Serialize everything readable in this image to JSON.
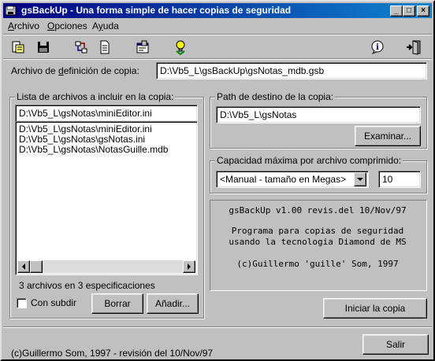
{
  "window": {
    "title": "gsBackUp - Una forma simple de hacer copias de seguridad",
    "controls": {
      "minimize": "_",
      "maximize": "□",
      "close": "×"
    }
  },
  "menu": [
    {
      "label": "Archivo",
      "accel": "A",
      "rest": "rchivo"
    },
    {
      "label": "Opciones",
      "accel": "O",
      "rest": "pciones"
    },
    {
      "label": "Ayuda",
      "accel": "y",
      "pre": "A",
      "rest": "uda"
    }
  ],
  "toolbar": {
    "icons": [
      "open-file-icon",
      "save-icon",
      "organize-icon",
      "document-icon",
      "properties-icon",
      "run-bulb-icon",
      "info-icon",
      "exit-door-icon"
    ]
  },
  "definition": {
    "label_pre": "Archivo de ",
    "label_accel": "d",
    "label_post": "efinición de copia:",
    "value": "D:\\Vb5_L\\gsBackUp\\gsNotas_mdb.gsb"
  },
  "file_list": {
    "title": "Lista de archivos a incluir en la copia:",
    "input_value": "D:\\Vb5_L\\gsNotas\\miniEditor.ini",
    "items": [
      "D:\\Vb5_L\\gsNotas\\miniEditor.ini",
      "D:\\Vb5_L\\gsNotas\\gsNotas.ini",
      "D:\\Vb5_L\\gsNotas\\NotasGuille.mdb"
    ],
    "count_text": "3 archivos en 3 especificaciones",
    "subdir_label": "Con subdir",
    "subdir_checked": false,
    "remove_label": "Borrar",
    "add_label": "Añadir..."
  },
  "destination": {
    "title": "Path de destino de la copia:",
    "value": "D:\\Vb5_L\\gsNotas",
    "browse_label": "Examinar..."
  },
  "capacity": {
    "title": "Capacidad máxima por archivo comprimido:",
    "selected": "<Manual - tamaño en Megas>",
    "size_value": "10"
  },
  "about": {
    "lines": [
      "gsBackUp v1.00 revis.del 10/Nov/97",
      "",
      "Programa para copias de seguridad",
      "usando la tecnologia Diamond de MS",
      "",
      "(c)Guillermo 'guille' Som, 1997"
    ]
  },
  "start_label": "Iniciar la copia",
  "status": {
    "text": "(c)Guillermo Som, 1997 - revisión del 10/Nov/97",
    "exit_label": "Salir"
  },
  "colors": {
    "face": "#c0c0c0",
    "title_start": "#000080",
    "title_end": "#1084d0"
  }
}
